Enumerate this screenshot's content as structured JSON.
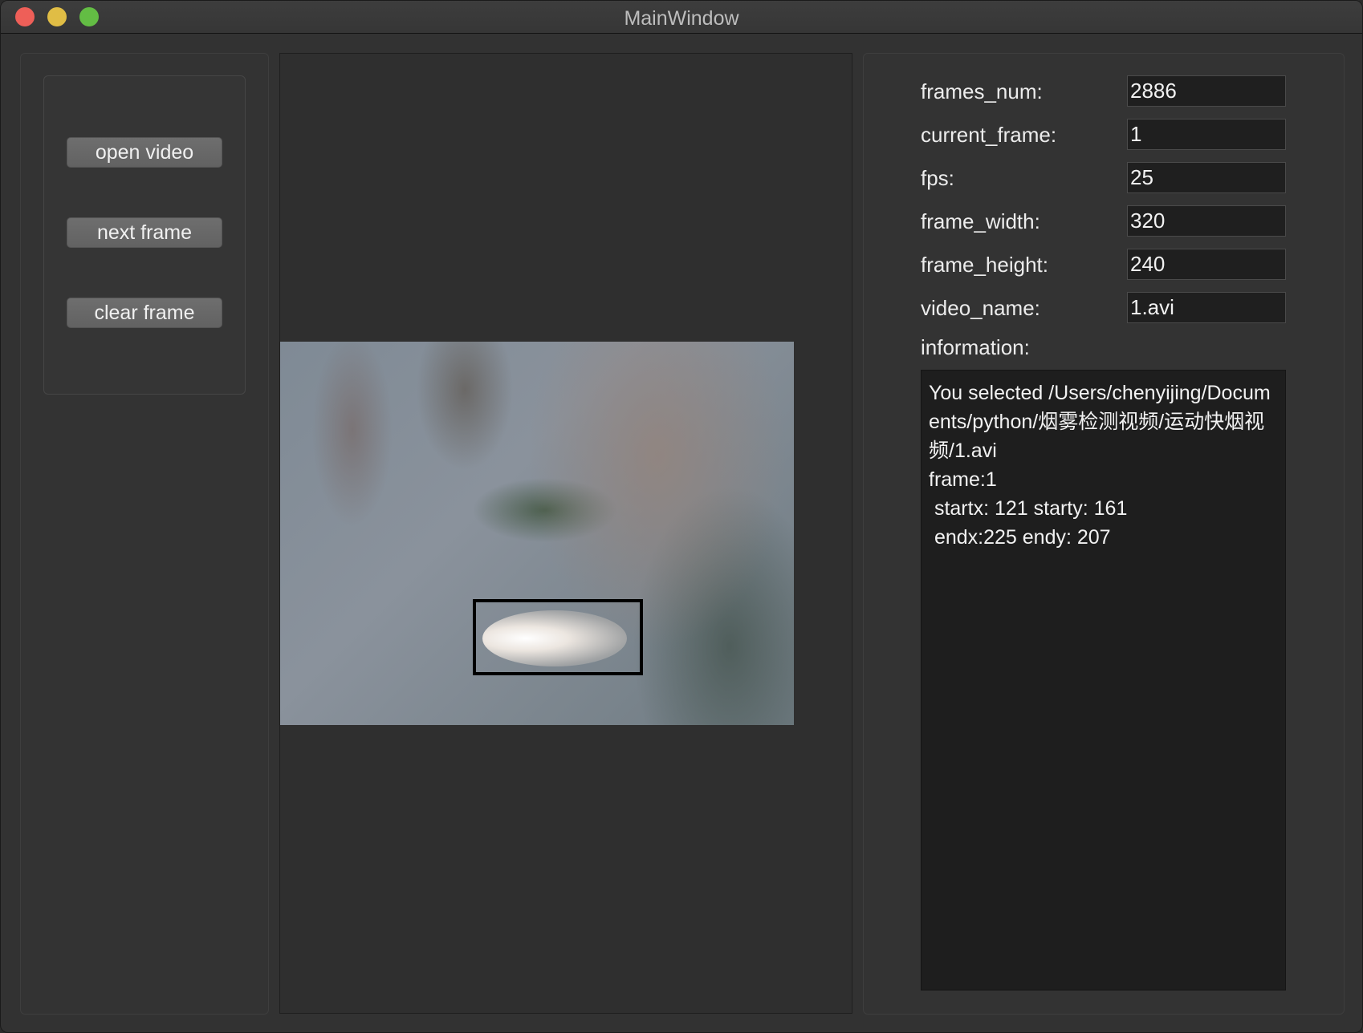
{
  "window": {
    "title": "MainWindow",
    "controls": {
      "close": "#ee5f58",
      "minimize": "#e0bd45",
      "maximize": "#63bd44"
    }
  },
  "controls": {
    "open_video": "open video",
    "next_frame": "next frame",
    "clear_frame": "clear frame"
  },
  "fields": [
    {
      "label": "frames_num:",
      "value": "2886"
    },
    {
      "label": "current_frame:",
      "value": "1"
    },
    {
      "label": "fps:",
      "value": "25"
    },
    {
      "label": "frame_width:",
      "value": "320"
    },
    {
      "label": "frame_height:",
      "value": "240"
    },
    {
      "label": "video_name:",
      "value": "1.avi"
    }
  ],
  "information": {
    "label": "information:",
    "text": "You selected /Users/chenyijing/Documents/python/烟雾检测视频/运动快烟视频/1.avi\nframe:1\n startx: 121 starty: 161\n endx:225 endy: 207"
  },
  "detection_box_color": "#000000"
}
